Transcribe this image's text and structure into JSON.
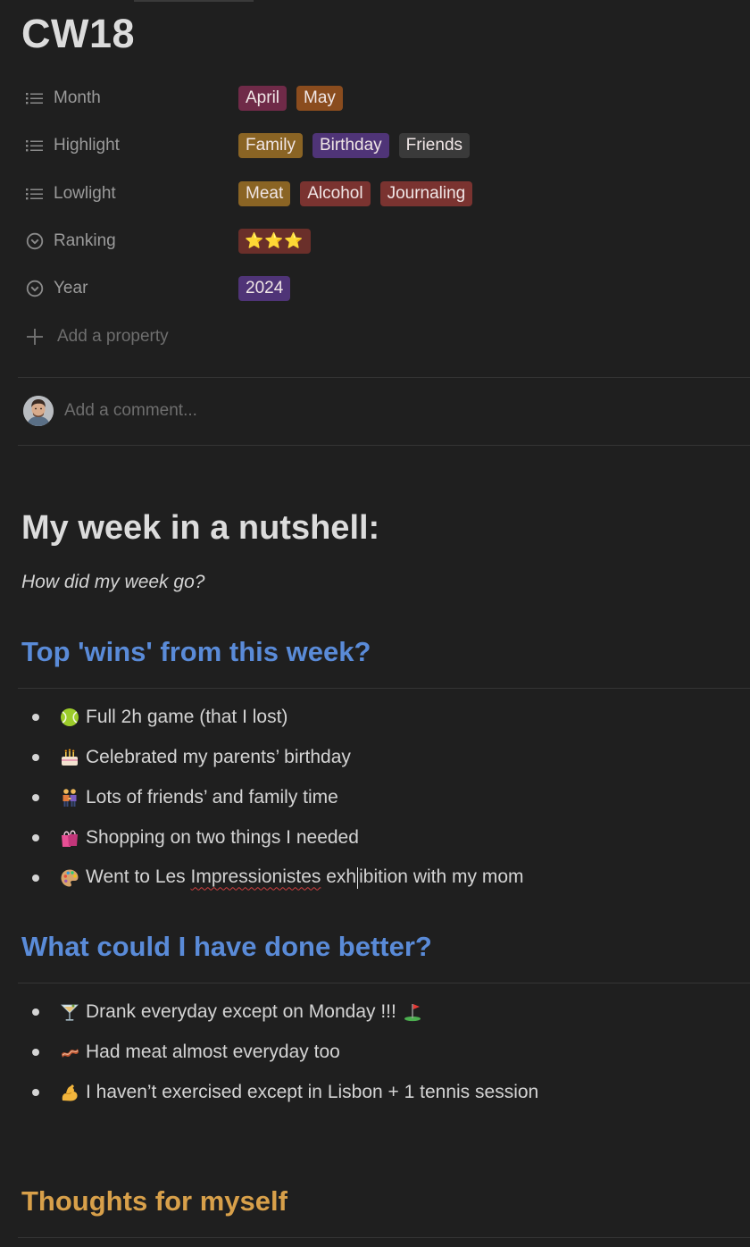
{
  "page": {
    "title": "CW18"
  },
  "properties": [
    {
      "label": "Month",
      "icon": "list-icon",
      "tags": [
        {
          "label": "April",
          "color": "#6f2a48"
        },
        {
          "label": "May",
          "color": "#8a4c1e"
        }
      ]
    },
    {
      "label": "Highlight",
      "icon": "list-icon",
      "tags": [
        {
          "label": "Family",
          "color": "#8a6424"
        },
        {
          "label": "Birthday",
          "color": "#4f3477"
        },
        {
          "label": "Friends",
          "color": "#3a3a3a"
        }
      ]
    },
    {
      "label": "Lowlight",
      "icon": "list-icon",
      "tags": [
        {
          "label": "Meat",
          "color": "#8a6424"
        },
        {
          "label": "Alcohol",
          "color": "#7a3330"
        },
        {
          "label": "Journaling",
          "color": "#7a3330"
        }
      ]
    },
    {
      "label": "Ranking",
      "icon": "select-icon",
      "tags": [
        {
          "label": "⭐⭐⭐",
          "color": "#6a2f2a",
          "stars": 3
        }
      ]
    },
    {
      "label": "Year",
      "icon": "select-icon",
      "tags": [
        {
          "label": "2024",
          "color": "#4f3477"
        }
      ]
    }
  ],
  "add_property_label": "Add a property",
  "comment": {
    "placeholder": "Add a comment..."
  },
  "content": {
    "heading": "My week in a nutshell:",
    "subtitle": "How did my week go?",
    "wins_heading": "Top 'wins' from this week?",
    "wins": [
      {
        "icon": "tennis-ball-icon",
        "text": "Full 2h game (that I lost)"
      },
      {
        "icon": "birthday-cake-icon",
        "text": "Celebrated my parents’ birthday"
      },
      {
        "icon": "people-holding-hands-icon",
        "text": "Lots of friends’ and family time"
      },
      {
        "icon": "shopping-bags-icon",
        "text": "Shopping on two things I needed"
      },
      {
        "icon": "artist-palette-icon",
        "text_before": "Went to Les ",
        "text_spell": "Impressionistes",
        "text_mid": " exh",
        "text_after": "ibition with my mom"
      }
    ],
    "better_heading": "What could I have done better?",
    "better": [
      {
        "icon": "cocktail-glass-icon",
        "text": "Drank everyday except on Monday !!!",
        "trailing_icon": "golf-flag-icon"
      },
      {
        "icon": "bacon-icon",
        "text": "Had meat almost everyday too"
      },
      {
        "icon": "flexed-biceps-icon",
        "text": "I haven’t exercised except in Lisbon + 1 tennis session"
      }
    ],
    "thoughts_heading": "Thoughts for myself"
  }
}
